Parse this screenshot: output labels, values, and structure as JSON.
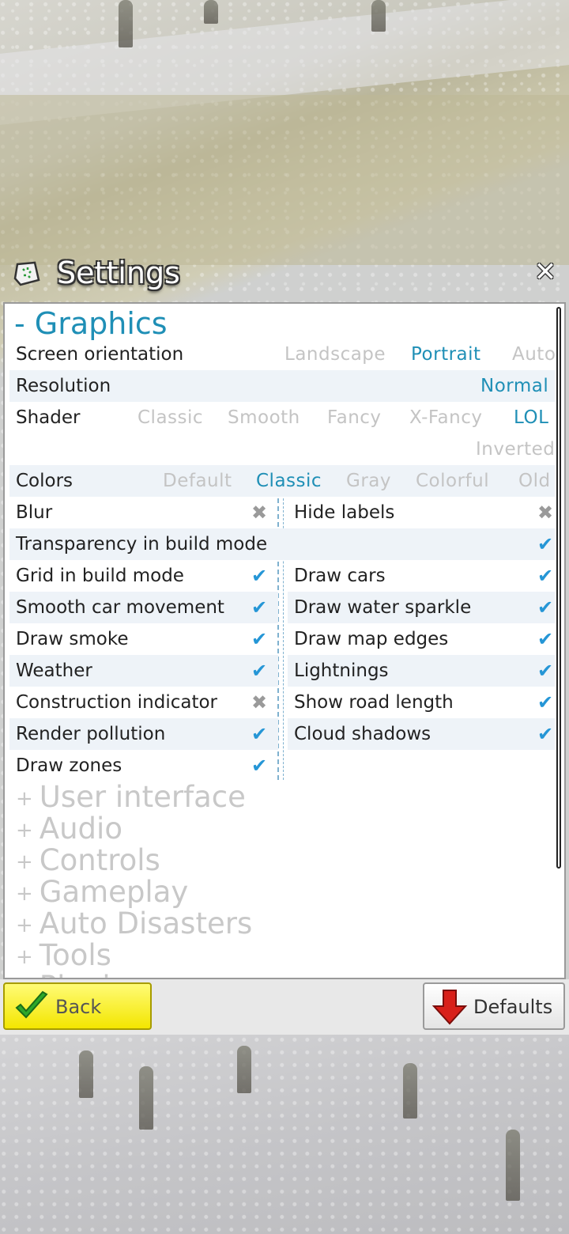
{
  "window": {
    "title": "Settings",
    "close_icon": "close-icon"
  },
  "graphics": {
    "section_title": "- Graphics",
    "screen_orientation": {
      "label": "Screen orientation",
      "options": [
        "Landscape",
        "Portrait",
        "Auto"
      ],
      "selected": "Portrait"
    },
    "resolution": {
      "label": "Resolution",
      "value": "Normal"
    },
    "shader": {
      "label": "Shader",
      "options": [
        "Classic",
        "Smooth",
        "Fancy",
        "X-Fancy",
        "LOL",
        "Inverted"
      ],
      "selected": "LOL"
    },
    "colors": {
      "label": "Colors",
      "options": [
        "Default",
        "Classic",
        "Gray",
        "Colorful",
        "Old"
      ],
      "selected": "Classic"
    },
    "toggles_left": [
      {
        "label": "Blur",
        "checked": false
      },
      {
        "label": "Transparency in build mode",
        "checked": true
      },
      {
        "label": "Grid in build mode",
        "checked": true
      },
      {
        "label": "Smooth car movement",
        "checked": true
      },
      {
        "label": "Draw smoke",
        "checked": true
      },
      {
        "label": "Weather",
        "checked": true
      },
      {
        "label": "Construction indicator",
        "checked": false
      },
      {
        "label": "Render pollution",
        "checked": true
      },
      {
        "label": "Draw zones",
        "checked": true
      }
    ],
    "toggles_right": [
      {
        "label": "Hide labels",
        "checked": false
      },
      {
        "label": "Draw cars",
        "checked": true
      },
      {
        "label": "Draw water sparkle",
        "checked": true
      },
      {
        "label": "Draw map edges",
        "checked": true
      },
      {
        "label": "Lightnings",
        "checked": true
      },
      {
        "label": "Show road length",
        "checked": true
      },
      {
        "label": "Cloud shadows",
        "checked": true
      }
    ],
    "check_on": "✔",
    "check_off": "✖"
  },
  "collapsed_sections": [
    {
      "prefix": "+",
      "label": "User interface"
    },
    {
      "prefix": "+",
      "label": "Audio"
    },
    {
      "prefix": "+",
      "label": "Controls"
    },
    {
      "prefix": "+",
      "label": "Gameplay"
    },
    {
      "prefix": "+",
      "label": "Auto Disasters"
    },
    {
      "prefix": "+",
      "label": "Tools"
    },
    {
      "prefix": "+",
      "label": "Plugins"
    }
  ],
  "footer": {
    "back_label": "Back",
    "defaults_label": "Defaults"
  },
  "colors": {
    "accent": "#1f8fb6",
    "check_on": "#2596d6",
    "check_off": "#9a9a9a",
    "back_button": "#f3e600",
    "defaults_arrow": "#d8201a"
  }
}
